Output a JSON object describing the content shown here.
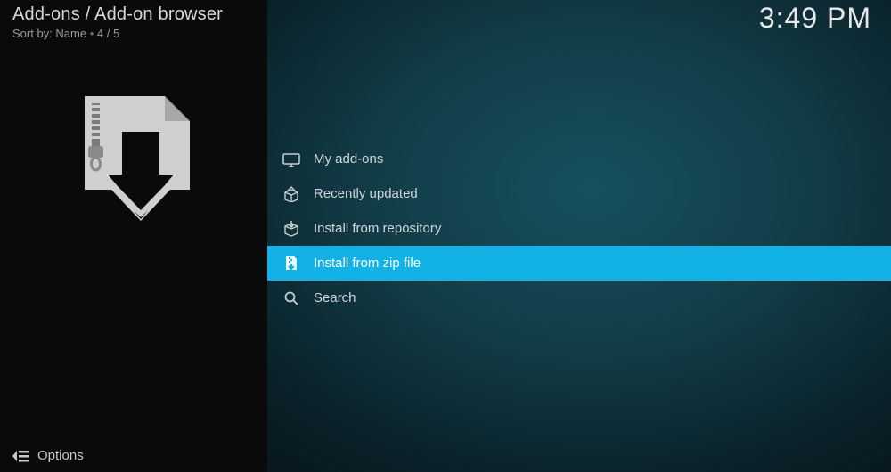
{
  "header": {
    "breadcrumb": "Add-ons / Add-on browser",
    "sort_label": "Sort by:",
    "sort_value": "Name",
    "position": "4 / 5",
    "clock": "3:49 PM"
  },
  "menu": {
    "items": [
      {
        "label": "My add-ons",
        "icon": "tv-icon",
        "selected": false
      },
      {
        "label": "Recently updated",
        "icon": "box-open-icon",
        "selected": false
      },
      {
        "label": "Install from repository",
        "icon": "box-down-icon",
        "selected": false
      },
      {
        "label": "Install from zip file",
        "icon": "zip-file-icon",
        "selected": true
      },
      {
        "label": "Search",
        "icon": "search-icon",
        "selected": false
      }
    ]
  },
  "footer": {
    "options_label": "Options"
  },
  "colors": {
    "highlight": "#12b2e7",
    "sidebar_bg": "#0a0a0a",
    "text": "#d0d6d8"
  }
}
